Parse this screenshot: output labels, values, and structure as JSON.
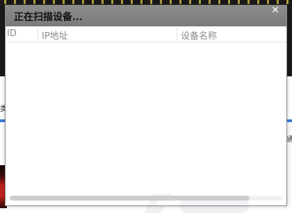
{
  "dialog": {
    "title": "正在扫描设备...",
    "close_icon": "close-icon",
    "columns": [
      {
        "label": "ID"
      },
      {
        "label": "IP地址"
      },
      {
        "label": "设备名称"
      }
    ],
    "rows": [],
    "scrollbar": {
      "thumb_fraction": 0.88
    }
  },
  "background": {
    "left_glyph": "类",
    "right_glyph": "通"
  }
}
